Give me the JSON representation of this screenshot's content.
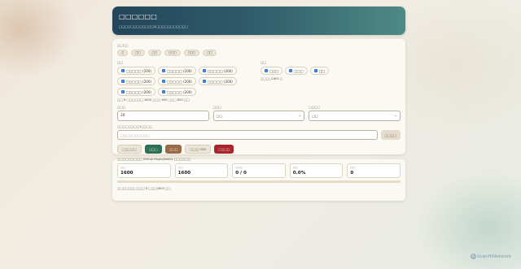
{
  "header": {
    "title": "□□□□□□",
    "subtitle": "□□□□□□□□□□□□2□□□□□□□□□□□"
  },
  "filters": {
    "section_label": "□□□□",
    "quick_buttons": [
      "□",
      "□□",
      "□□",
      "□□□",
      "□□□",
      "□□"
    ],
    "cat_label": "□□",
    "categories": [
      "□□□□□ (200)",
      "□□□□□ (200)",
      "□□□□□ (200)",
      "□□□□□ (200)",
      "□□□□□ (200)",
      "□□□□□ (200)",
      "□□□□□ (200)",
      "□□□□□ (200)"
    ],
    "cat_summary": "□□ 8 □□□□□□ 1600 □□□ 800 □□□ 800 □□",
    "type_label": "□□",
    "types": [
      "□□□",
      "□□□",
      "□□"
    ],
    "type_summary": "□□□□1600 □"
  },
  "inputs": {
    "count_label": "□□□",
    "count_value": "20",
    "select1_label": "□□□",
    "select1_value": "□□",
    "select2_label": "□□□□",
    "select2_value": "□□",
    "search_label": "□□□□□□□□1□□□□",
    "search_placeholder": "□□□□□□□□□□",
    "search_button": "□□□□"
  },
  "actions": {
    "btn1": "□□□□□",
    "btn2": "□□□",
    "btn3": "□□□",
    "btn4": "□□□ CSV",
    "btn5": "□□□□"
  },
  "note": "□□□□□□□□□ GitHub Pages/Netlify □□□□□□",
  "stats": [
    {
      "key": "□□",
      "value": "1600"
    },
    {
      "key": "□□",
      "value": "1600"
    },
    {
      "key": "□□□",
      "value": "0 / 0"
    },
    {
      "key": "□□",
      "value": "0.0%"
    },
    {
      "key": "□□",
      "value": "0"
    }
  ],
  "progress": 0,
  "footer_text": "□□□□□□□□□□ 8 □□□1600 □□",
  "logo_text": "ScanHiNetwork",
  "colors": {
    "header_start": "#24465a",
    "header_end": "#4e8a86",
    "btn_green": "#2f6f55",
    "btn_brown": "#9a6a45",
    "btn_red": "#a8232a",
    "checkbox": "#2a6fd6"
  }
}
